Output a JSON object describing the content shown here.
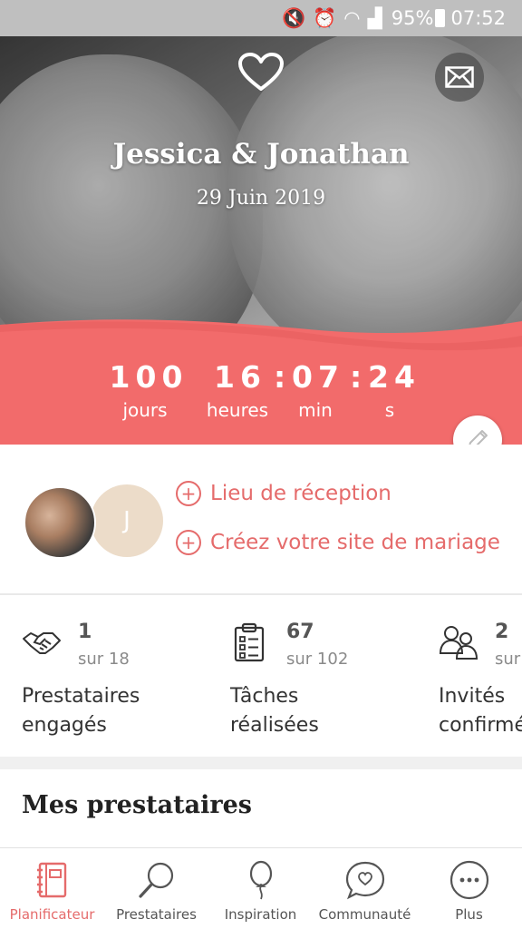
{
  "status_bar": {
    "battery": "95%",
    "time": "07:52"
  },
  "hero": {
    "couple_name": "Jessica & Jonathan",
    "wedding_date": "29 Juin 2019"
  },
  "countdown": {
    "days": "100",
    "hours": "16",
    "minutes": "07",
    "seconds": "24",
    "separator": ":",
    "days_label": "jours",
    "hours_label": "heures",
    "minutes_label": "min",
    "seconds_label": "s"
  },
  "profile": {
    "partner_initial": "J",
    "links": [
      {
        "label": "Lieu de réception"
      },
      {
        "label": "Créez votre site de mariage"
      }
    ]
  },
  "stats": [
    {
      "icon": "handshake-icon",
      "count": "1",
      "total": "sur 18",
      "label_line1": "Prestataires",
      "label_line2": "engagés"
    },
    {
      "icon": "clipboard-icon",
      "count": "67",
      "total": "sur 102",
      "label_line1": "Tâches",
      "label_line2": "réalisées"
    },
    {
      "icon": "guests-icon",
      "count": "2",
      "total": "sur",
      "label_line1": "Invités",
      "label_line2": "confirmés"
    }
  ],
  "section_title": "Mes prestataires",
  "nav": [
    {
      "label": "Planificateur",
      "icon": "planner-icon",
      "active": true
    },
    {
      "label": "Prestataires",
      "icon": "search-icon",
      "active": false
    },
    {
      "label": "Inspiration",
      "icon": "balloon-icon",
      "active": false
    },
    {
      "label": "Communauté",
      "icon": "chat-heart-icon",
      "active": false
    },
    {
      "label": "Plus",
      "icon": "more-icon",
      "active": false
    }
  ],
  "colors": {
    "accent": "#e56b6b",
    "pink_band": "#f26b6b",
    "status_bar": "#bfbfbf"
  }
}
